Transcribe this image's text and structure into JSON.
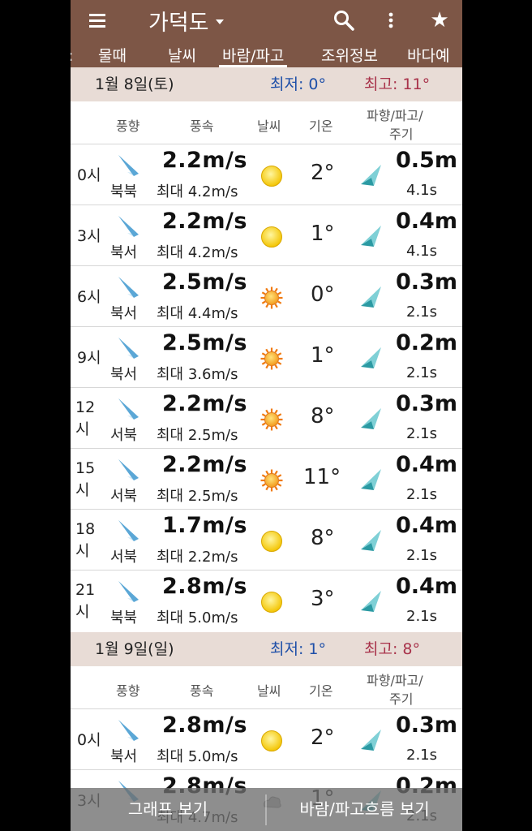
{
  "topbar": {
    "title": "가덕도",
    "menu_icon": "hamburger-icon",
    "search_icon": "search-icon",
    "more_icon": "more-vert-icon",
    "star_icon": "star-icon",
    "star_glyph": "★"
  },
  "tabs": [
    "물때",
    "날씨",
    "바람/파고",
    "조위정보",
    "바다예"
  ],
  "active_tab": "바람/파고",
  "columns": {
    "dir": "풍향",
    "speed": "풍속",
    "weather": "날씨",
    "temp": "기온",
    "wave1": "파향/파고/",
    "wave2": "주기"
  },
  "days": [
    {
      "date": "1월 8일(토)",
      "low": "최저: 0°",
      "high": "최고: 11°",
      "rows": [
        {
          "time1": "0시",
          "time2": "",
          "dir": "북북",
          "speed": "2.2m/s",
          "gust": "최대 4.2m/s",
          "weather": "sun-icon",
          "temp": "2°",
          "wave": "0.5m",
          "period": "4.1s"
        },
        {
          "time1": "3시",
          "time2": "",
          "dir": "북서",
          "speed": "2.2m/s",
          "gust": "최대 4.2m/s",
          "weather": "sun-icon",
          "temp": "1°",
          "wave": "0.4m",
          "period": "4.1s"
        },
        {
          "time1": "6시",
          "time2": "",
          "dir": "북서",
          "speed": "2.5m/s",
          "gust": "최대 4.4m/s",
          "weather": "sun-rays-icon",
          "temp": "0°",
          "wave": "0.3m",
          "period": "2.1s"
        },
        {
          "time1": "9시",
          "time2": "",
          "dir": "북서",
          "speed": "2.5m/s",
          "gust": "최대 3.6m/s",
          "weather": "sun-rays-icon",
          "temp": "1°",
          "wave": "0.2m",
          "period": "2.1s"
        },
        {
          "time1": "12",
          "time2": "시",
          "dir": "서북",
          "speed": "2.2m/s",
          "gust": "최대 2.5m/s",
          "weather": "sun-rays-icon",
          "temp": "8°",
          "wave": "0.3m",
          "period": "2.1s"
        },
        {
          "time1": "15",
          "time2": "시",
          "dir": "서북",
          "speed": "2.2m/s",
          "gust": "최대 2.5m/s",
          "weather": "sun-rays-icon",
          "temp": "11°",
          "wave": "0.4m",
          "period": "2.1s"
        },
        {
          "time1": "18",
          "time2": "시",
          "dir": "서북",
          "speed": "1.7m/s",
          "gust": "최대 2.2m/s",
          "weather": "sun-icon",
          "temp": "8°",
          "wave": "0.4m",
          "period": "2.1s"
        },
        {
          "time1": "21",
          "time2": "시",
          "dir": "북북",
          "speed": "2.8m/s",
          "gust": "최대 5.0m/s",
          "weather": "sun-icon",
          "temp": "3°",
          "wave": "0.4m",
          "period": "2.1s"
        }
      ]
    },
    {
      "date": "1월 9일(일)",
      "low": "최저: 1°",
      "high": "최고: 8°",
      "rows": [
        {
          "time1": "0시",
          "time2": "",
          "dir": "북서",
          "speed": "2.8m/s",
          "gust": "최대 5.0m/s",
          "weather": "sun-icon",
          "temp": "2°",
          "wave": "0.3m",
          "period": "2.1s"
        },
        {
          "time1": "3시",
          "time2": "",
          "dir": "",
          "speed": "2.8m/s",
          "gust": "최대 4.7m/s",
          "weather": "cloud-icon",
          "temp": "1°",
          "wave": "0.2m",
          "period": "2.1s"
        }
      ]
    }
  ],
  "bottom": {
    "graph": "그래프 보기",
    "flow": "바람/파고흐름 보기"
  }
}
